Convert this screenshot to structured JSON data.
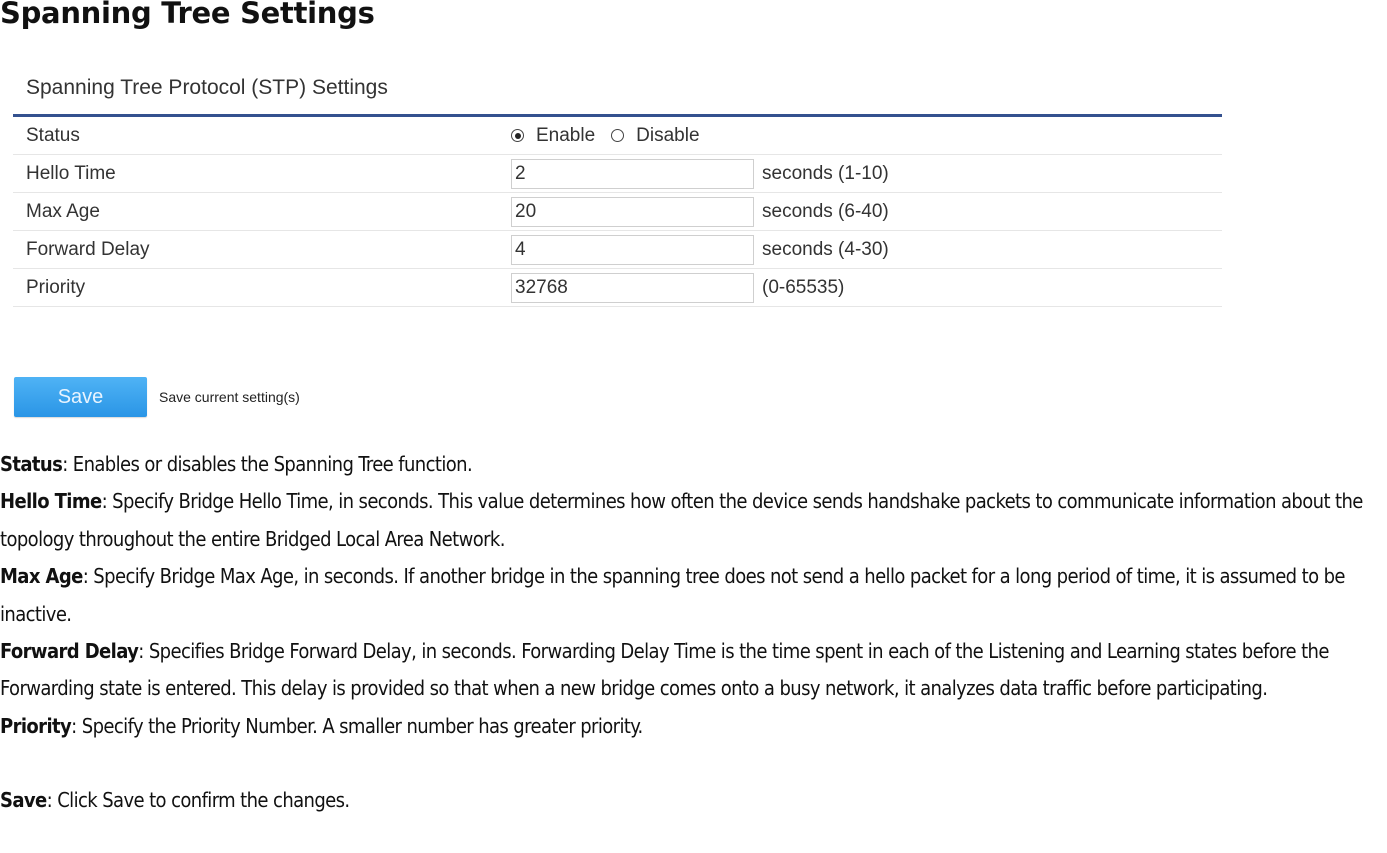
{
  "page_title": "Spanning Tree Settings",
  "panel": {
    "title": "Spanning Tree Protocol (STP) Settings",
    "status": {
      "label": "Status",
      "options": [
        "Enable",
        "Disable"
      ],
      "selected": "Enable"
    },
    "fields": [
      {
        "label": "Hello Time",
        "value": "2",
        "hint": "seconds (1-10)"
      },
      {
        "label": "Max Age",
        "value": "20",
        "hint": "seconds (6-40)"
      },
      {
        "label": "Forward Delay",
        "value": "4",
        "hint": "seconds (4-30)"
      },
      {
        "label": "Priority",
        "value": "32768",
        "hint": "(0-65535)"
      }
    ]
  },
  "save": {
    "button_label": "Save",
    "note": "Save current setting(s)"
  },
  "descriptions": [
    {
      "term": "Status",
      "text": ": Enables or disables the Spanning Tree function."
    },
    {
      "term": "Hello Time",
      "text": ": Specify Bridge Hello Time, in seconds. This value determines how often the device sends handshake packets to communicate information about the topology throughout the entire Bridged Local Area Network."
    },
    {
      "term": "Max Age",
      "text": ": Specify Bridge Max Age, in seconds. If another bridge in the spanning tree does not send a hello packet for a long period of time, it is assumed to be inactive."
    },
    {
      "term": "Forward Delay",
      "text": ": Specifies Bridge Forward Delay, in seconds. Forwarding Delay Time is the time spent in each of the Listening and Learning states before the Forwarding state is entered. This delay is provided so that when a new bridge comes onto a busy network, it analyzes data traffic before participating."
    },
    {
      "term": "Priority",
      "text": ": Specify the Priority Number. A smaller number has greater priority."
    },
    {
      "term": "Save",
      "text": ": Click Save to confirm the changes."
    }
  ],
  "colors": {
    "header_line": "#34518f",
    "save_button": "#2a95e6"
  }
}
